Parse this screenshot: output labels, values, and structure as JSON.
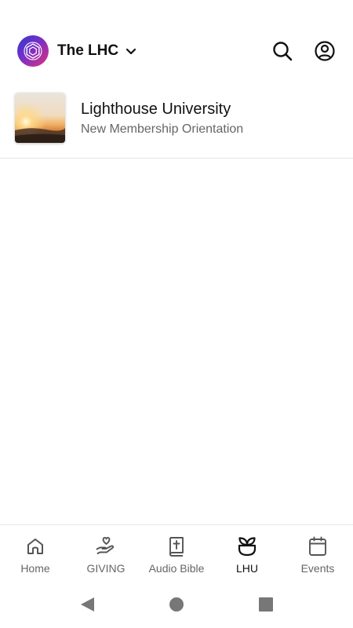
{
  "header": {
    "org_name": "The LHC",
    "logo_icon": "lighthouse-logo-icon",
    "dropdown_icon": "chevron-down-icon",
    "search_icon": "search-icon",
    "account_icon": "account-icon"
  },
  "list": {
    "items": [
      {
        "title": "Lighthouse University",
        "subtitle": "New Membership Orientation",
        "thumbnail": "sunset-image"
      }
    ]
  },
  "tabbar": {
    "active": "LHU",
    "tabs": [
      {
        "label": "Home",
        "icon": "home-icon"
      },
      {
        "label": "GIVING",
        "icon": "giving-hand-heart-icon"
      },
      {
        "label": "Audio Bible",
        "icon": "bible-icon"
      },
      {
        "label": "LHU",
        "icon": "plant-pot-icon"
      },
      {
        "label": "Events",
        "icon": "calendar-icon"
      }
    ]
  },
  "system_nav": {
    "back_icon": "back-triangle-icon",
    "home_icon": "home-circle-icon",
    "recents_icon": "recents-square-icon"
  },
  "colors": {
    "active_text": "#111111",
    "inactive_text": "#666666",
    "divider": "#e6e6e6",
    "logo_gradient": [
      "#2a3bd1",
      "#7a2fc7",
      "#e0307d"
    ]
  }
}
